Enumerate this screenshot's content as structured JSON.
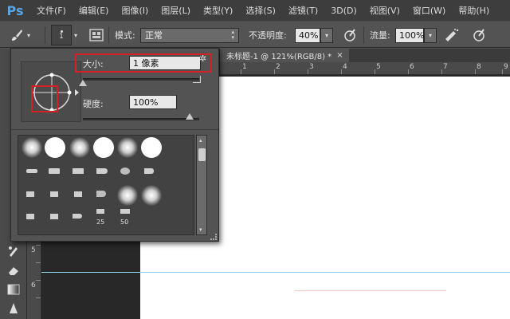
{
  "app": {
    "logo": "Ps"
  },
  "menu": [
    "文件(F)",
    "编辑(E)",
    "图像(I)",
    "图层(L)",
    "类型(Y)",
    "选择(S)",
    "滤镜(T)",
    "3D(D)",
    "视图(V)",
    "窗口(W)",
    "帮助(H)"
  ],
  "options": {
    "brush_size": "1",
    "mode_label": "模式:",
    "mode_value": "正常",
    "opacity_label": "不透明度:",
    "opacity_value": "40%",
    "flow_label": "流量:",
    "flow_value": "100%"
  },
  "document": {
    "tab_title": "未标题-1 @ 121%(RGB/8) *",
    "hruler_labels": [
      "1",
      "2",
      "3",
      "4",
      "5",
      "6",
      "7",
      "8",
      "9"
    ],
    "vruler_labels": [
      "5",
      "6"
    ]
  },
  "brush_panel": {
    "size_label": "大小:",
    "size_value": "1 像素",
    "size_fraction": 0.0,
    "hardness_label": "硬度:",
    "hardness_value": "100%",
    "hardness_fraction": 1.0,
    "preset_numbers": [
      "25",
      "50"
    ]
  },
  "icons": {
    "brush": "brush-icon",
    "gear": "gear-icon",
    "airbrush": "airbrush-icon",
    "pressure": "pressure-icon"
  },
  "colors": {
    "highlight": "#d32224",
    "guide": "#8fd3ea"
  }
}
